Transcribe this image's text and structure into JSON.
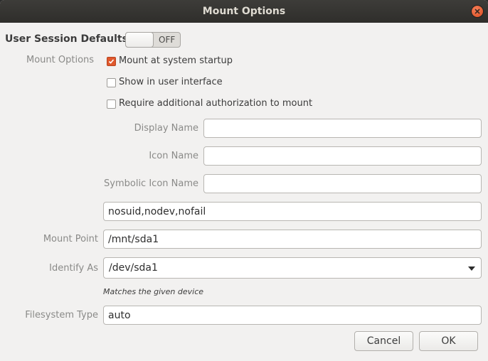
{
  "window": {
    "title": "Mount Options"
  },
  "session": {
    "label": "User Session Defaults",
    "switch_state": "OFF"
  },
  "mount_options": {
    "label": "Mount Options",
    "checkboxes": [
      {
        "label": "Mount at system startup",
        "checked": true
      },
      {
        "label": "Show in user interface",
        "checked": false
      },
      {
        "label": "Require additional authorization to mount",
        "checked": false
      }
    ]
  },
  "fields": {
    "display_name": {
      "label": "Display Name",
      "value": ""
    },
    "icon_name": {
      "label": "Icon Name",
      "value": ""
    },
    "symbolic_icon_name": {
      "label": "Symbolic Icon Name",
      "value": ""
    },
    "options": {
      "value": "nosuid,nodev,nofail"
    },
    "mount_point": {
      "label": "Mount Point",
      "value": "/mnt/sda1"
    },
    "identify_as": {
      "label": "Identify As",
      "value": "/dev/sda1",
      "hint": "Matches the given device"
    },
    "filesystem_type": {
      "label": "Filesystem Type",
      "value": "auto"
    }
  },
  "buttons": {
    "cancel": "Cancel",
    "ok": "OK"
  },
  "colors": {
    "accent": "#e0582c",
    "titlebar": "#3d3c39",
    "background": "#f2f1f0"
  },
  "icons": {
    "close": "close-icon",
    "dropdown": "chevron-down-icon",
    "check": "checkmark-icon"
  }
}
